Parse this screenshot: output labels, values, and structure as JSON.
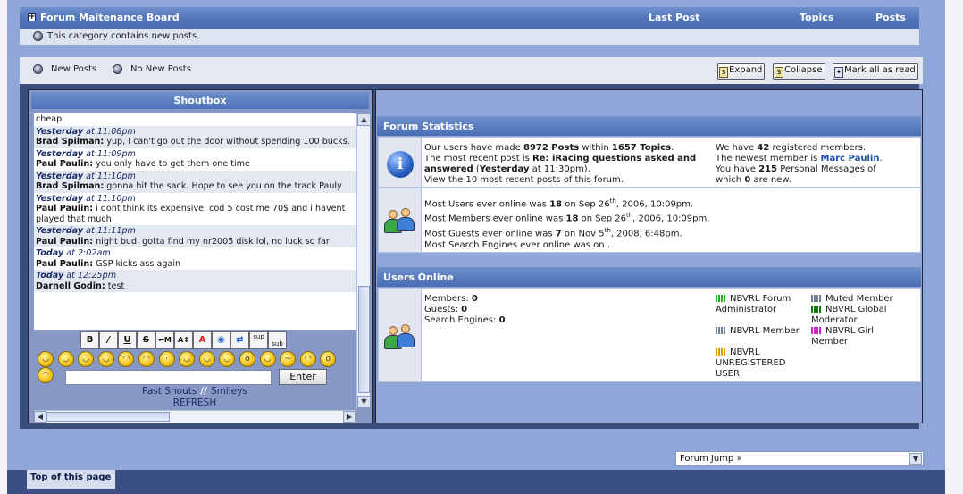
{
  "category": {
    "title": "Forum Maitenance Board",
    "cols": [
      "Last Post",
      "Topics",
      "Posts"
    ],
    "info": "This category contains new posts."
  },
  "legend": {
    "new_posts": "New Posts",
    "no_new_posts": "No New Posts",
    "buttons": [
      "Expand",
      "Collapse",
      "Mark all as read"
    ]
  },
  "shoutbox": {
    "title": "Shoutbox",
    "messages": [
      {
        "day": "",
        "time": "",
        "author": "",
        "text": "cheap"
      },
      {
        "day": "Yesterday",
        "time": "at 11:08pm",
        "author": "Brad Spilman:",
        "text": "yup, I can't go out the door without spending 100 bucks."
      },
      {
        "day": "Yesterday",
        "time": "at 11:09pm",
        "author": "Paul Paulin:",
        "text": "you only have to get them one time"
      },
      {
        "day": "Yesterday",
        "time": "at 11:10pm",
        "author": "Brad Spilman:",
        "text": "gonna hit the sack. Hope to see you on the track Pauly"
      },
      {
        "day": "Yesterday",
        "time": "at 11:10pm",
        "author": "Paul Paulin:",
        "text": "i dont think its expensive, cod 5 cost me 70$ and i havent played that much"
      },
      {
        "day": "Yesterday",
        "time": "at 11:11pm",
        "author": "Paul Paulin:",
        "text": "night bud, gotta find my nr2005 disk lol, no luck so far"
      },
      {
        "day": "Today",
        "time": "at 2:02am",
        "author": "Paul Paulin:",
        "text": "GSP kicks ass again"
      },
      {
        "day": "Today",
        "time": "at 12:25pm",
        "author": "Darnell Godin:",
        "text": "test"
      }
    ],
    "format_buttons": [
      "B",
      "/",
      "U",
      "S",
      "←M",
      "A↕",
      "A",
      "◉",
      "⇄",
      "sup",
      "sub"
    ],
    "smiley_count": 16,
    "enter_label": "Enter",
    "input_value": "",
    "past_shouts": "Past Shouts",
    "separator": "//",
    "smileys": "Smileys",
    "refresh": "REFRESH"
  },
  "stats": {
    "title": "Forum Statistics",
    "line1_a": "Our users have made",
    "posts": "8972 Posts",
    "line1_b": "within",
    "topics": "1657 Topics",
    "line2_a": "The most recent post is",
    "recent_post": "Re: iRacing questions asked and answered",
    "recent_when": "Yesterday",
    "recent_time": "at 11:30pm).",
    "line4": "View the 10 most recent posts of this forum.",
    "members_a": "We have",
    "members_n": "42",
    "members_b": "registered members.",
    "newest_a": "The newest member is",
    "newest": "Marc Paulin",
    "pm_a": "You have",
    "pm_n": "215",
    "pm_b": "Personal Messages of",
    "pm_c": "which",
    "pm_new": "0",
    "pm_d": "are new.",
    "online_users": {
      "a": "Most Users ever online was",
      "n": "18",
      "b": "on Sep 26",
      "sup": "th",
      "c": ", 2006, 10:09pm."
    },
    "online_members": {
      "a": "Most Members ever online was",
      "n": "18",
      "b": "on Sep 26",
      "sup": "th",
      "c": ", 2006, 10:09pm."
    },
    "online_guests": {
      "a": "Most Guests ever online was",
      "n": "7",
      "b": "on Nov 5",
      "sup": "th",
      "c": ", 2008, 6:48pm."
    },
    "online_engines": "Most Search Engines ever online was on ."
  },
  "users_online": {
    "title": "Users Online",
    "members_label": "Members:",
    "members": "0",
    "guests_label": "Guests:",
    "guests": "0",
    "engines_label": "Search Engines:",
    "engines": "0",
    "groups": [
      {
        "name": "NBVRL Forum Administrator",
        "color": "#22b022"
      },
      {
        "name": "Muted Member",
        "color": "#6a7f9a"
      },
      {
        "name": "NBVRL Global Moderator",
        "color": "#117a11"
      },
      {
        "name": "NBVRL Member",
        "color": "#6a7f9a"
      },
      {
        "name": "NBVRL Girl Member",
        "color": "#d020c8"
      },
      {
        "name": "NBVRL UNREGISTERED USER",
        "color": "#e0a000"
      }
    ]
  },
  "footer": {
    "forum_jump": "Forum Jump »",
    "top_of_page": "Top of this page"
  }
}
